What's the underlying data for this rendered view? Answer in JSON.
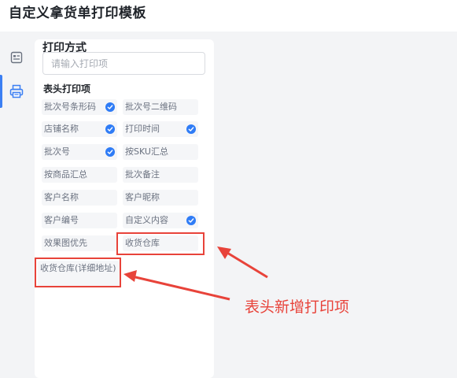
{
  "header": {
    "title": "自定义拿货单打印模板"
  },
  "siderail": {
    "items": [
      {
        "icon": "template-icon",
        "active": false
      },
      {
        "icon": "printer-icon",
        "active": true
      }
    ]
  },
  "panel": {
    "section_title": "打印方式",
    "search_placeholder": "请输入打印项",
    "sub_title": "表头打印项",
    "items": [
      {
        "label": "批次号条形码",
        "checked": true
      },
      {
        "label": "批次号二维码",
        "checked": false
      },
      {
        "label": "店铺名称",
        "checked": true
      },
      {
        "label": "打印时间",
        "checked": true
      },
      {
        "label": "批次号",
        "checked": true
      },
      {
        "label": "按SKU汇总",
        "checked": false
      },
      {
        "label": "按商品汇总",
        "checked": false
      },
      {
        "label": "批次备注",
        "checked": false
      },
      {
        "label": "客户名称",
        "checked": false
      },
      {
        "label": "客户昵称",
        "checked": false
      },
      {
        "label": "客户编号",
        "checked": false
      },
      {
        "label": "自定义内容",
        "checked": true
      },
      {
        "label": "效果图优先",
        "checked": false
      },
      {
        "label": "收货仓库",
        "checked": false
      },
      {
        "label": "收货仓库(详细地址)",
        "checked": false
      }
    ]
  },
  "annotation": {
    "text": "表头新增打印项",
    "color": "#e8433a"
  },
  "colors": {
    "accent": "#2f7cf6",
    "annotation": "#e8433a"
  }
}
